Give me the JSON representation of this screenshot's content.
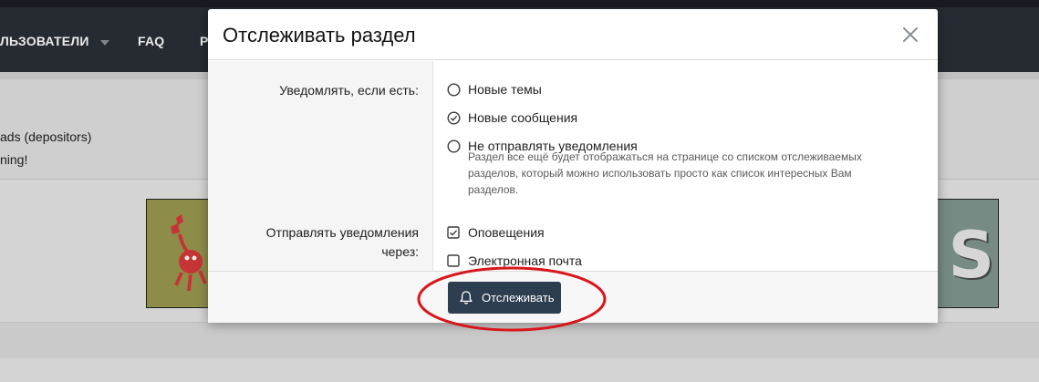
{
  "background": {
    "nav_users": "ЛЬЗОВАТЕЛИ",
    "nav_faq": "FAQ",
    "nav_partial": "P",
    "line1": "ads (depositors)",
    "line2": "ning!"
  },
  "modal": {
    "title": "Отслеживать раздел",
    "notify_label": "Уведомлять, если есть:",
    "options": [
      {
        "label": "Новые темы",
        "checked": false
      },
      {
        "label": "Новые сообщения",
        "checked": true
      },
      {
        "label": "Не отправлять уведомления",
        "checked": false
      }
    ],
    "hint": "Раздел все ещё будет отображаться на странице со списком отслеживаемых разделов, который можно использовать просто как список интересных Вам разделов.",
    "send_label": "Отправлять уведомления через:",
    "channels": [
      {
        "label": "Оповещения",
        "checked": true
      },
      {
        "label": "Электронная почта",
        "checked": false
      }
    ],
    "submit_label": "Отслеживать"
  },
  "colors": {
    "button_bg": "#2d3e50",
    "highlight": "#d9161c"
  },
  "icons": {
    "close": "close-icon",
    "bell": "bell-icon",
    "radio_checked": "check-circle-icon",
    "checkbox_checked": "checkbox-checked-icon"
  }
}
